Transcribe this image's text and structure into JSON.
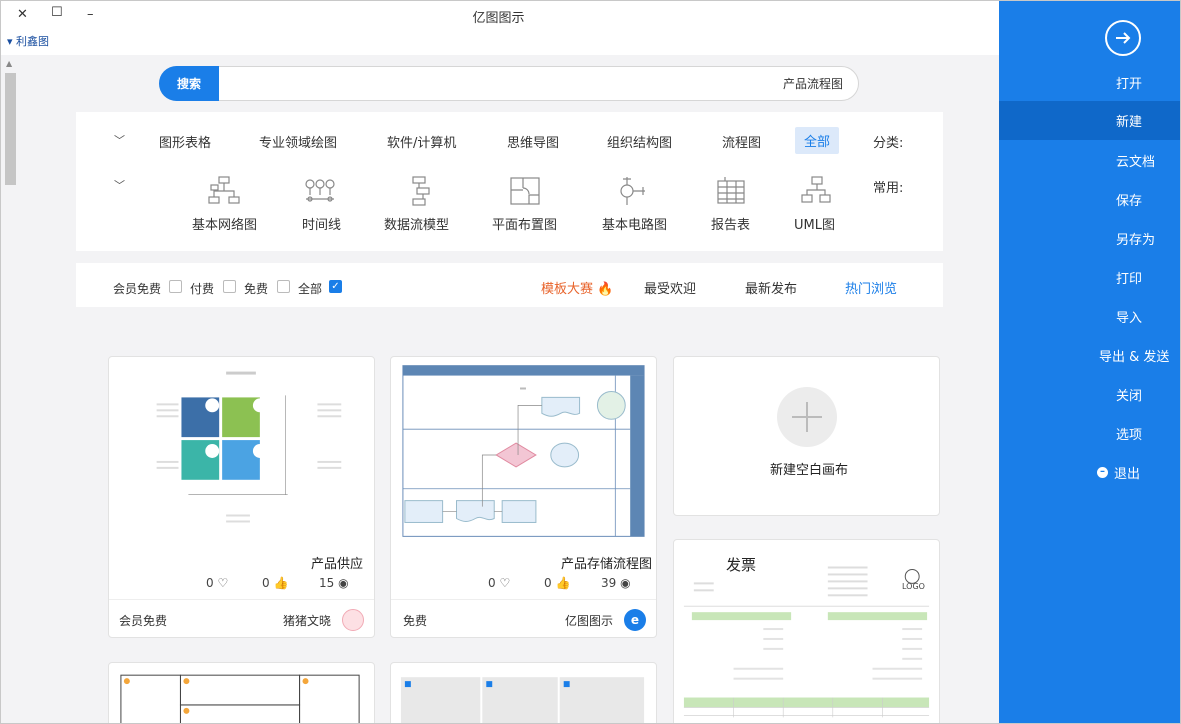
{
  "window": {
    "title": "亿图图示",
    "close": "✕",
    "maximize": "☐",
    "minimize": "–"
  },
  "top_link": "▾ 利鑫图",
  "sidebar": {
    "items": [
      {
        "label": "打开"
      },
      {
        "label": "新建"
      },
      {
        "label": "云文档"
      },
      {
        "label": "保存"
      },
      {
        "label": "另存为"
      },
      {
        "label": "打印"
      },
      {
        "label": "导入"
      },
      {
        "label": "导出 & 发送"
      },
      {
        "label": "关闭"
      },
      {
        "label": "选项"
      },
      {
        "label": "退出"
      }
    ],
    "active_index": 1
  },
  "search": {
    "button": "搜索",
    "value": "产品流程图"
  },
  "categories": {
    "label": "分类:",
    "items": [
      "全部",
      "流程图",
      "组织结构图",
      "思维导图",
      "软件/计算机",
      "专业领域绘图",
      "图形表格"
    ]
  },
  "common": {
    "label": "常用:",
    "items": [
      "UML图",
      "报告表",
      "基本电路图",
      "平面布置图",
      "数据流模型",
      "时间线",
      "基本网络图"
    ]
  },
  "tabs": [
    "热门浏览",
    "最新发布",
    "最受欢迎",
    "模板大赛"
  ],
  "filters": [
    "全部",
    "免费",
    "付费",
    "会员免费"
  ],
  "cards": {
    "new_blank": "新建空白画布",
    "c1": {
      "title": "产品存储流程图",
      "views": "39",
      "likes": "0",
      "favs": "0",
      "author": "亿图图示",
      "price": "免费"
    },
    "c2": {
      "title": "产品供应",
      "views": "15",
      "likes": "0",
      "favs": "0",
      "author": "猪猪文晓",
      "price": "会员免费"
    },
    "c3": {
      "title": "发票",
      "logo": "LOGO"
    }
  },
  "colors": {
    "accent": "#1a7ee8",
    "sidebar": "#1a7ee8",
    "hot": "#e8642c"
  }
}
